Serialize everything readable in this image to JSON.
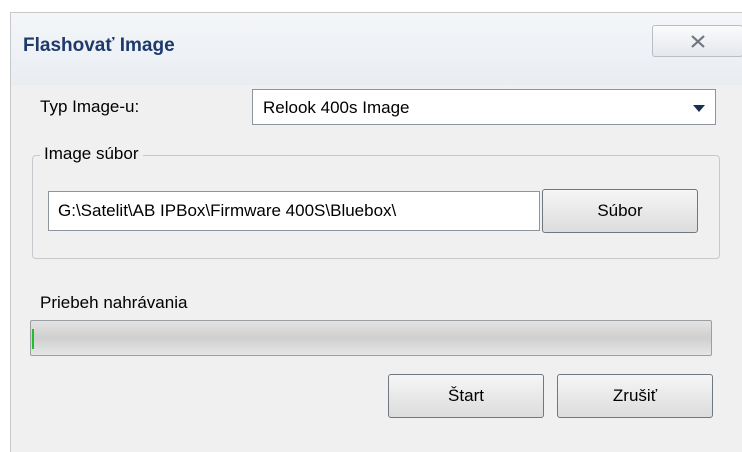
{
  "window": {
    "title": "Flashovať Image"
  },
  "image_type": {
    "label": "Typ Image-u:",
    "selected": "Relook 400s Image"
  },
  "image_file": {
    "group_label": "Image súbor",
    "path": "G:\\Satelit\\AB IPBox\\Firmware 400S\\Bluebox\\",
    "browse_label": "Súbor"
  },
  "progress": {
    "label": "Priebeh nahrávania",
    "fraction": 0.003,
    "fill_color": "#1fbf28"
  },
  "actions": {
    "start_label": "Štart",
    "cancel_label": "Zrušiť"
  },
  "icons": {
    "close": "close-icon",
    "dropdown": "chevron-down-icon"
  }
}
